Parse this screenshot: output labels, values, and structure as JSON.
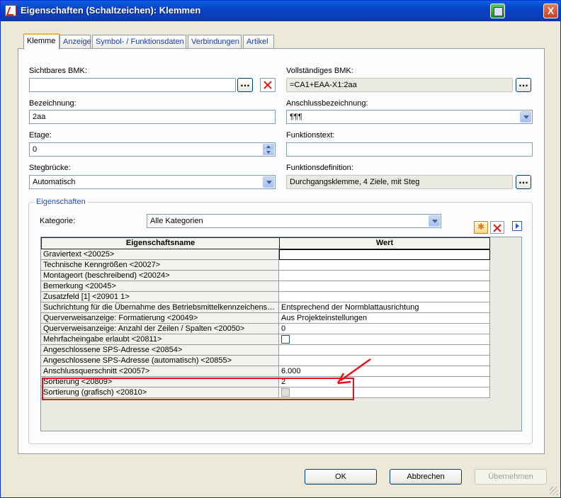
{
  "window": {
    "title": "Eigenschaften (Schaltzeichen): Klemmen",
    "close_glyph": "X"
  },
  "tabs": [
    {
      "label": "Klemme",
      "active": true
    },
    {
      "label": "Anzeige"
    },
    {
      "label": "Symbol- / Funktionsdaten"
    },
    {
      "label": "Verbindungen"
    },
    {
      "label": "Artikel"
    }
  ],
  "form": {
    "sichtbares_bmk": {
      "label": "Sichtbares BMK:",
      "value": ""
    },
    "vollstaendiges_bmk": {
      "label": "Vollständiges BMK:",
      "value": "=CA1+EAA-X1:2aa"
    },
    "bezeichnung": {
      "label": "Bezeichnung:",
      "value": "2aa"
    },
    "anschlussbezeichnung": {
      "label": "Anschlussbezeichnung:",
      "value": "¶¶¶"
    },
    "etage": {
      "label": "Etage:",
      "value": "0"
    },
    "funktionstext": {
      "label": "Funktionstext:",
      "value": ""
    },
    "stegbruecke": {
      "label": "Stegbrücke:",
      "value": "Automatisch"
    },
    "funktionsdefinition": {
      "label": "Funktionsdefinition:",
      "value": "Durchgangsklemme, 4 Ziele, mit Steg"
    },
    "dots": "..."
  },
  "properties": {
    "group_title": "Eigenschaften",
    "category_label": "Kategorie:",
    "category_value": "Alle Kategorien",
    "col_name": "Eigenschaftsname",
    "col_value": "Wert",
    "rows": [
      {
        "name": "Graviertext <20025>",
        "value": ""
      },
      {
        "name": "Technische Kenngrößen <20027>",
        "value": ""
      },
      {
        "name": "Montageort (beschreibend) <20024>",
        "value": ""
      },
      {
        "name": "Bemerkung <20045>",
        "value": ""
      },
      {
        "name": "Zusatzfeld [1] <20901 1>",
        "value": ""
      },
      {
        "name": "Suchrichtung für die Übernahme des Betriebsmittelkennzeichens <...",
        "value": "Entsprechend der Normblattausrichtung"
      },
      {
        "name": "Querverweisanzeige: Formatierung <20049>",
        "value": "Aus Projekteinstellungen"
      },
      {
        "name": "Querverweisanzeige: Anzahl der Zeilen / Spalten <20050>",
        "value": "0"
      },
      {
        "name": "Mehrfacheingabe erlaubt <20811>",
        "value": ""
      },
      {
        "name": "Angeschlossene SPS-Adresse <20854>",
        "value": ""
      },
      {
        "name": "Angeschlossene SPS-Adresse (automatisch) <20855>",
        "value": ""
      },
      {
        "name": "Anschlussquerschnitt <20057>",
        "value": "6.000"
      },
      {
        "name": "Sortierung <20809>",
        "value": "2"
      },
      {
        "name": "Sortierung (grafisch) <20810>",
        "value": ""
      }
    ]
  },
  "buttons": {
    "ok": "OK",
    "cancel": "Abbrechen",
    "apply": "Übernehmen"
  },
  "colors": {
    "highlight": "#e8121d",
    "titlebar": "#0a3fb8"
  }
}
